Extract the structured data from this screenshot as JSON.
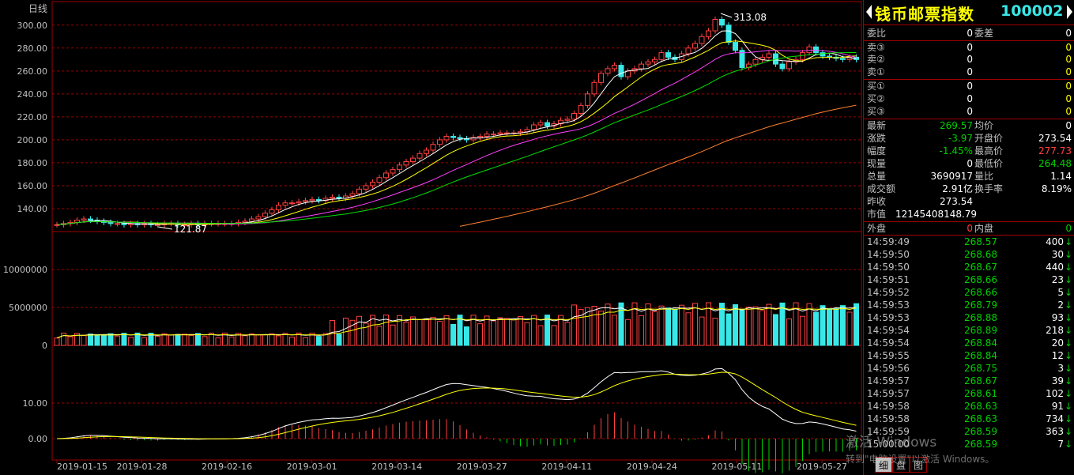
{
  "chart_label": "日线",
  "security": {
    "name": "钱币邮票指数",
    "code": "100002"
  },
  "price_axis": [
    "300.00",
    "280.00",
    "260.00",
    "240.00",
    "220.00",
    "200.00",
    "180.00",
    "160.00",
    "140.00"
  ],
  "volume_axis": [
    "10000000",
    "5000000",
    "0"
  ],
  "macd_axis": [
    "10.00",
    "0.00"
  ],
  "date_axis": [
    "2019-01-15",
    "2019-01-28",
    "2019-02-16",
    "2019-03-01",
    "2019-03-14",
    "2019-03-27",
    "2019-04-11",
    "2019-04-24",
    "2019-05-11",
    "2019-05-27"
  ],
  "annotations": {
    "high": "313.08",
    "low": "121.87"
  },
  "order_book": {
    "weibi_label": "委比",
    "weibi": "0",
    "weicha_label": "委差",
    "weicha": "0",
    "sell": [
      {
        "label": "卖③",
        "price": "0",
        "vol": "0"
      },
      {
        "label": "卖②",
        "price": "0",
        "vol": "0"
      },
      {
        "label": "卖①",
        "price": "0",
        "vol": "0"
      }
    ],
    "buy": [
      {
        "label": "买①",
        "price": "0",
        "vol": "0"
      },
      {
        "label": "买②",
        "price": "0",
        "vol": "0"
      },
      {
        "label": "买③",
        "price": "0",
        "vol": "0"
      }
    ]
  },
  "quote": {
    "latest_label": "最新",
    "latest": "269.57",
    "avg_label": "均价",
    "avg": "0",
    "change_label": "涨跌",
    "change": "-3.97",
    "open_label": "开盘价",
    "open": "273.54",
    "pct_label": "幅度",
    "pct": "-1.45%",
    "high_label": "最高价",
    "high": "277.73",
    "cur_vol_label": "现量",
    "cur_vol": "0",
    "low_label": "最低价",
    "low": "264.48",
    "total_vol_label": "总量",
    "total_vol": "3690917",
    "vol_ratio_label": "量比",
    "vol_ratio": "1.14",
    "amount_label": "成交额",
    "amount": "2.91亿",
    "turnover_label": "换手率",
    "turnover": "8.19%",
    "prev_close_label": "昨收",
    "prev_close": "273.54",
    "mkt_val_label": "市值",
    "mkt_val": "12145408148.79",
    "outer_label": "外盘",
    "outer": "0",
    "inner_label": "内盘",
    "inner": "0"
  },
  "ticks": [
    {
      "t": "14:59:49",
      "p": "268.57",
      "q": "400"
    },
    {
      "t": "14:59:50",
      "p": "268.68",
      "q": "30"
    },
    {
      "t": "14:59:50",
      "p": "268.67",
      "q": "440"
    },
    {
      "t": "14:59:51",
      "p": "268.66",
      "q": "23"
    },
    {
      "t": "14:59:52",
      "p": "268.66",
      "q": "5"
    },
    {
      "t": "14:59:53",
      "p": "268.79",
      "q": "2"
    },
    {
      "t": "14:59:53",
      "p": "268.88",
      "q": "93"
    },
    {
      "t": "14:59:54",
      "p": "268.89",
      "q": "218"
    },
    {
      "t": "14:59:54",
      "p": "268.84",
      "q": "20"
    },
    {
      "t": "14:59:55",
      "p": "268.84",
      "q": "12"
    },
    {
      "t": "14:59:56",
      "p": "268.75",
      "q": "3"
    },
    {
      "t": "14:59:57",
      "p": "268.67",
      "q": "39"
    },
    {
      "t": "14:59:57",
      "p": "268.61",
      "q": "102"
    },
    {
      "t": "14:59:58",
      "p": "268.63",
      "q": "91"
    },
    {
      "t": "14:59:58",
      "p": "268.63",
      "q": "734"
    },
    {
      "t": "14:59:59",
      "p": "268.59",
      "q": "363"
    },
    {
      "t": "15:00:00",
      "p": "268.59",
      "q": "7"
    }
  ],
  "tick_arrow": "↓",
  "tabs": [
    "细",
    "盘",
    "图"
  ],
  "watermark": {
    "line1": "激活 Windows",
    "line2": "转到\"电脑设置\"以激活 Windows。"
  },
  "colors": {
    "up": "#ff4040",
    "down": "#38e8e8",
    "grid": "#a00000",
    "ma5": "#ffffff",
    "ma10": "#ffff00",
    "ma20": "#ff40ff",
    "ma30": "#00e000",
    "ma60": "#ff8030"
  },
  "chart_data": {
    "type": "candlestick",
    "price_ylim": [
      120,
      315
    ],
    "candles_close": [
      126,
      127,
      128,
      130,
      131,
      130,
      129,
      128,
      127,
      127,
      126,
      127,
      126,
      127,
      126,
      126,
      127,
      127,
      126,
      126,
      127,
      126,
      127,
      127,
      127,
      127,
      127,
      128,
      129,
      131,
      133,
      136,
      139,
      143,
      145,
      145,
      146,
      147,
      148,
      147,
      149,
      150,
      149,
      151,
      153,
      157,
      160,
      163,
      167,
      171,
      174,
      178,
      181,
      184,
      188,
      191,
      196,
      200,
      203,
      202,
      201,
      200,
      202,
      203,
      205,
      205,
      206,
      206,
      206,
      207,
      209,
      213,
      215,
      212,
      214,
      217,
      218,
      223,
      230,
      240,
      250,
      258,
      262,
      265,
      255,
      260,
      262,
      266,
      268,
      270,
      276,
      272,
      270,
      275,
      280,
      284,
      290,
      295,
      305,
      300,
      285,
      278,
      263,
      266,
      270,
      272,
      275,
      266,
      262,
      268,
      270,
      276,
      281,
      276,
      273,
      272,
      271,
      270,
      272,
      270
    ]
  }
}
